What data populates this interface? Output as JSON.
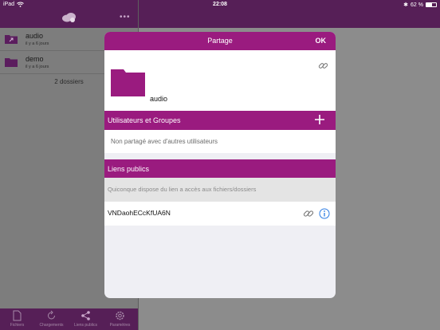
{
  "statusbar": {
    "device": "iPad",
    "time": "22:08",
    "battery": "62 %"
  },
  "files": [
    {
      "name": "audio",
      "subtitle": "il y a 6 jours"
    },
    {
      "name": "demo",
      "subtitle": "il y a 6 jours"
    }
  ],
  "file_count": "2 dossiers",
  "tabs": [
    {
      "label": "Fichiers"
    },
    {
      "label": "Chargements"
    },
    {
      "label": "Liens publics"
    },
    {
      "label": "Paramètres"
    }
  ],
  "modal": {
    "title": "Partage",
    "ok_label": "OK",
    "item_name": "audio",
    "users_section_title": "Utilisateurs et Groupes",
    "users_empty_text": "Non partagé avec d'autres utilisateurs",
    "links_section_title": "Liens publics",
    "links_info_text": "Quiconque dispose du lien a accès aux fichiers/dossiers",
    "link_token": "VNDaohECcKfUA6N"
  },
  "colors": {
    "brand": "#9a1b7f",
    "header_dark": "#561f57",
    "info_blue": "#2a7ae2"
  }
}
